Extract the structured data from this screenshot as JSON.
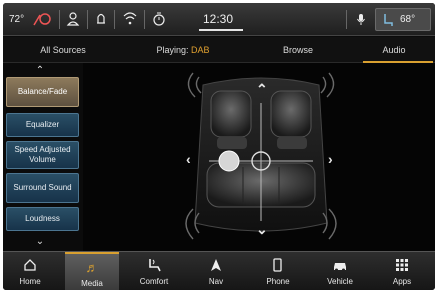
{
  "status": {
    "outside_temp": "72°",
    "time": "12:30",
    "climate_temp": "68°"
  },
  "tabs": [
    {
      "label": "All Sources"
    },
    {
      "label_prefix": "Playing: ",
      "label_value": "DAB"
    },
    {
      "label": "Browse"
    },
    {
      "label": "Audio",
      "active": true
    }
  ],
  "audio_menu": {
    "items": [
      {
        "label": "Balance/Fade",
        "active": true
      },
      {
        "label": "Equalizer"
      },
      {
        "label": "Speed Adjusted Volume"
      },
      {
        "label": "Surround Sound"
      },
      {
        "label": "Loudness"
      }
    ]
  },
  "bottom_nav": [
    {
      "label": "Home",
      "icon": "home-icon"
    },
    {
      "label": "Media",
      "icon": "music-note-icon",
      "active": true
    },
    {
      "label": "Comfort",
      "icon": "seat-comfort-icon"
    },
    {
      "label": "Nav",
      "icon": "navigation-arrow-icon"
    },
    {
      "label": "Phone",
      "icon": "phone-icon"
    },
    {
      "label": "Vehicle",
      "icon": "car-icon"
    },
    {
      "label": "Apps",
      "icon": "apps-grid-icon"
    }
  ],
  "colors": {
    "accent": "#d9a030",
    "menu_button": "#1f4259",
    "menu_button_active": "#7a6a50"
  }
}
